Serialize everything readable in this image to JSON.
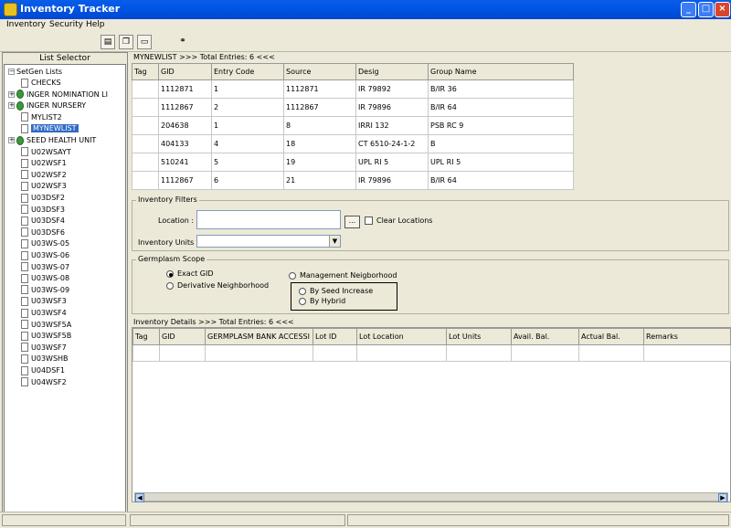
{
  "app": {
    "title": "Inventory Tracker"
  },
  "window_controls": {
    "minimize": "_",
    "maximize": "□",
    "close": "×"
  },
  "menu": [
    "Inventory",
    "Security",
    "Help"
  ],
  "toolbar": {
    "icons": [
      "new-icon",
      "copy-icon",
      "open-icon",
      "binoculars-icon"
    ]
  },
  "list_selector": {
    "title": "List Selector",
    "root": "SetGen Lists",
    "items": [
      {
        "label": "CHECKS",
        "icon": "file-icon",
        "expandable": false
      },
      {
        "label": "INGER NOMINATION LI",
        "icon": "globe-icon",
        "expandable": true
      },
      {
        "label": "INGER NURSERY",
        "icon": "globe-icon",
        "expandable": true
      },
      {
        "label": "MYLIST2",
        "icon": "file-icon",
        "expandable": false
      },
      {
        "label": "MYNEWLIST",
        "icon": "file-icon",
        "expandable": false,
        "selected": true
      },
      {
        "label": "SEED HEALTH UNIT",
        "icon": "globe-icon",
        "expandable": true
      },
      {
        "label": "U02WSAYT",
        "icon": "file-icon",
        "expandable": false
      },
      {
        "label": "U02WSF1",
        "icon": "file-icon",
        "expandable": false
      },
      {
        "label": "U02WSF2",
        "icon": "file-icon",
        "expandable": false
      },
      {
        "label": "U02WSF3",
        "icon": "file-icon",
        "expandable": false
      },
      {
        "label": "U03DSF2",
        "icon": "file-icon",
        "expandable": false
      },
      {
        "label": "U03DSF3",
        "icon": "file-icon",
        "expandable": false
      },
      {
        "label": "U03DSF4",
        "icon": "file-icon",
        "expandable": false
      },
      {
        "label": "U03DSF6",
        "icon": "file-icon",
        "expandable": false
      },
      {
        "label": "U03WS-05",
        "icon": "file-icon",
        "expandable": false
      },
      {
        "label": "U03WS-06",
        "icon": "file-icon",
        "expandable": false
      },
      {
        "label": "U03WS-07",
        "icon": "file-icon",
        "expandable": false
      },
      {
        "label": "U03WS-08",
        "icon": "file-icon",
        "expandable": false
      },
      {
        "label": "U03WS-09",
        "icon": "file-icon",
        "expandable": false
      },
      {
        "label": "U03WSF3",
        "icon": "file-icon",
        "expandable": false
      },
      {
        "label": "U03WSF4",
        "icon": "file-icon",
        "expandable": false
      },
      {
        "label": "U03WSF5A",
        "icon": "file-icon",
        "expandable": false
      },
      {
        "label": "U03WSF5B",
        "icon": "file-icon",
        "expandable": false
      },
      {
        "label": "U03WSF7",
        "icon": "file-icon",
        "expandable": false
      },
      {
        "label": "U03WSHB",
        "icon": "file-icon",
        "expandable": false
      },
      {
        "label": "U04DSF1",
        "icon": "file-icon",
        "expandable": false
      },
      {
        "label": "U04WSF2",
        "icon": "file-icon",
        "expandable": false
      }
    ]
  },
  "list_table": {
    "header": "MYNEWLIST >>> Total Entries: 6 <<<",
    "columns": [
      "Tag",
      "GID",
      "Entry Code",
      "Source",
      "Desig",
      "Group Name"
    ],
    "rows": [
      [
        "",
        "1112871",
        "1",
        "1112871",
        "IR 79892",
        "B/IR 36"
      ],
      [
        "",
        "1112867",
        "2",
        "1112867",
        "IR 79896",
        "B/IR 64"
      ],
      [
        "",
        "204638",
        "1",
        "8",
        "IRRI 132",
        "PSB RC 9"
      ],
      [
        "",
        "404133",
        "4",
        "18",
        "CT 6510-24-1-2",
        "B"
      ],
      [
        "",
        "510241",
        "5",
        "19",
        "UPL RI 5",
        "UPL RI 5"
      ],
      [
        "",
        "1112867",
        "6",
        "21",
        "IR 79896",
        "B/IR 64"
      ]
    ]
  },
  "filters": {
    "title": "Inventory Filters",
    "location_label": "Location :",
    "location_value": "",
    "browse_label": "...",
    "clear_label": "Clear Locations",
    "units_label": "Inventory Units :",
    "units_value": ""
  },
  "scope": {
    "title": "Germplasm Scope",
    "exact_label": "Exact GID",
    "derivative_label": "Derivative Neighborhood",
    "management_label": "Management Neigborhood",
    "seed_increase_label": "By Seed Increase",
    "hybrid_label": "By Hybrid",
    "selected": "exact"
  },
  "details_table": {
    "header": "Inventory Details >>> Total Entries: 6 <<<",
    "columns": [
      "Tag",
      "GID",
      "GERMPLASM BANK ACCESSI",
      "Lot ID",
      "Lot Location",
      "Lot Units",
      "Avail. Bal.",
      "Actual Bal.",
      "Remarks"
    ]
  }
}
